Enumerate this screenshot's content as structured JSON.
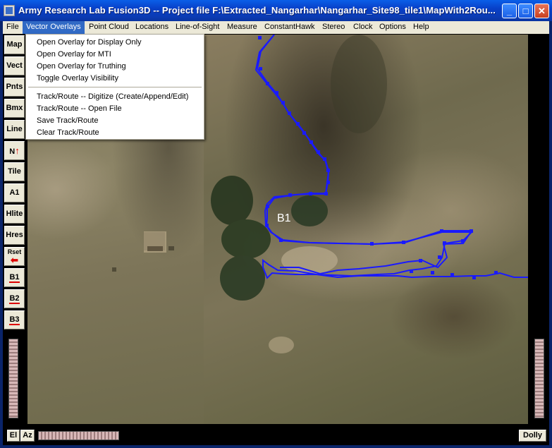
{
  "window": {
    "title": "Army Research Lab Fusion3D -- Project file F:\\Extracted_Nangarhar\\Nangarhar_Site98_tile1\\MapWith2Rou...",
    "minimize_glyph": "_",
    "maximize_glyph": "□",
    "close_glyph": "✕"
  },
  "menubar": {
    "items": [
      {
        "label": "File"
      },
      {
        "label": "Vector Overlays"
      },
      {
        "label": "Point Cloud"
      },
      {
        "label": "Locations"
      },
      {
        "label": "Line-of-Sight"
      },
      {
        "label": "Measure"
      },
      {
        "label": "ConstantHawk"
      },
      {
        "label": "Stereo"
      },
      {
        "label": "Clock"
      },
      {
        "label": "Options"
      },
      {
        "label": "Help"
      }
    ],
    "active": "Vector Overlays"
  },
  "dropdown": {
    "items": [
      {
        "label": "Open Overlay for Display Only"
      },
      {
        "label": "Open Overlay for MTI"
      },
      {
        "label": "Open Overlay for Truthing"
      },
      {
        "label": "Toggle Overlay Visibility"
      },
      {
        "label": "Track/Route -- Digitize (Create/Append/Edit)"
      },
      {
        "label": "Track/Route -- Open File"
      },
      {
        "label": "Save Track/Route"
      },
      {
        "label": "Clear Track/Route"
      }
    ]
  },
  "toolbar": {
    "buttons": [
      {
        "label": "Map"
      },
      {
        "label": "Vect"
      },
      {
        "label": "Pnts"
      },
      {
        "label": "Bmx"
      },
      {
        "label": "Line"
      },
      {
        "label": "N"
      },
      {
        "label": "Tile"
      },
      {
        "label": "A1"
      },
      {
        "label": "Hlite"
      },
      {
        "label": "Hres"
      },
      {
        "label": "Rset"
      },
      {
        "label": "B1"
      },
      {
        "label": "B2"
      },
      {
        "label": "B3"
      }
    ]
  },
  "map": {
    "route_color": "#1a1aff",
    "waypoint_label": "B1"
  },
  "bottom": {
    "el_label": "El",
    "az_label": "Az",
    "dolly_label": "Dolly"
  },
  "icons": {
    "north_arrow": "north-arrow-icon",
    "reset_arrow": "red-left-arrow-icon"
  }
}
